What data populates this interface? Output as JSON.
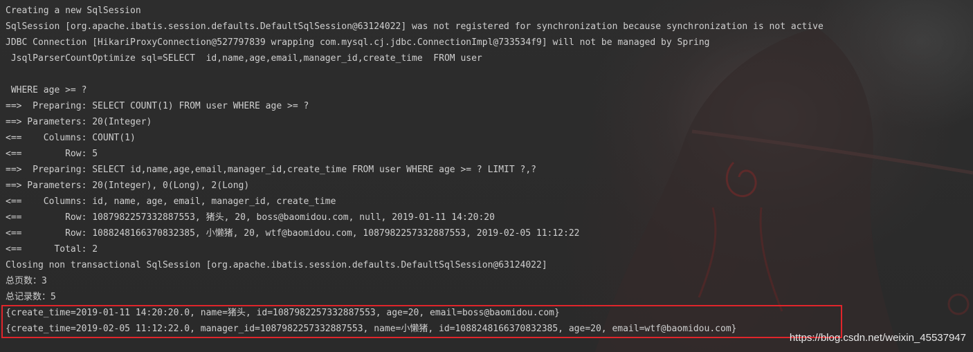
{
  "console": {
    "lines": [
      "Creating a new SqlSession",
      "SqlSession [org.apache.ibatis.session.defaults.DefaultSqlSession@63124022] was not registered for synchronization because synchronization is not active",
      "JDBC Connection [HikariProxyConnection@527797839 wrapping com.mysql.cj.jdbc.ConnectionImpl@733534f9] will not be managed by Spring",
      " JsqlParserCountOptimize sql=SELECT  id,name,age,email,manager_id,create_time  FROM user",
      "",
      " WHERE age >= ?",
      "==>  Preparing: SELECT COUNT(1) FROM user WHERE age >= ?",
      "==> Parameters: 20(Integer)",
      "<==    Columns: COUNT(1)",
      "<==        Row: 5",
      "==>  Preparing: SELECT id,name,age,email,manager_id,create_time FROM user WHERE age >= ? LIMIT ?,?",
      "==> Parameters: 20(Integer), 0(Long), 2(Long)",
      "<==    Columns: id, name, age, email, manager_id, create_time",
      "<==        Row: 1087982257332887553, 猪头, 20, boss@baomidou.com, null, 2019-01-11 14:20:20",
      "<==        Row: 1088248166370832385, 小懒猪, 20, wtf@baomidou.com, 1087982257332887553, 2019-02-05 11:12:22",
      "<==      Total: 2",
      "Closing non transactional SqlSession [org.apache.ibatis.session.defaults.DefaultSqlSession@63124022]",
      "总页数：3",
      "总记录数：5",
      "{create_time=2019-01-11 14:20:20.0, name=猪头, id=1087982257332887553, age=20, email=boss@baomidou.com}",
      "{create_time=2019-02-05 11:12:22.0, manager_id=1087982257332887553, name=小懒猪, id=1088248166370832385, age=20, email=wtf@baomidou.com}"
    ]
  },
  "watermark": "https://blog.csdn.net/weixin_45537947",
  "colors": {
    "background": "#2b2b2b",
    "text": "#cfcfcf",
    "highlight_border": "#e0252b",
    "watermark": "#e8e8e8"
  }
}
